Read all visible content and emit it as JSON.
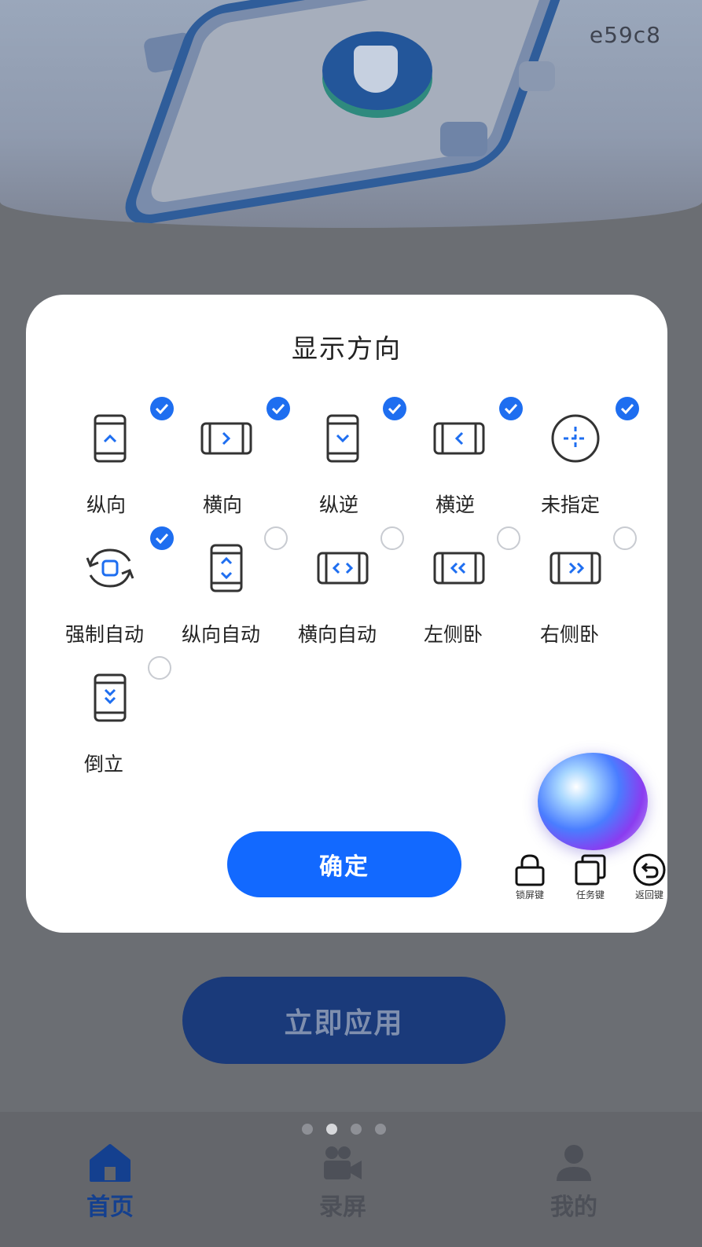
{
  "hero": {
    "code": "e59c8"
  },
  "dialog": {
    "title": "显示方向",
    "options": [
      {
        "label": "纵向",
        "checked": true,
        "icon": "portrait-up-icon"
      },
      {
        "label": "横向",
        "checked": true,
        "icon": "landscape-right-icon"
      },
      {
        "label": "纵逆",
        "checked": true,
        "icon": "portrait-down-icon"
      },
      {
        "label": "横逆",
        "checked": true,
        "icon": "landscape-left-icon"
      },
      {
        "label": "未指定",
        "checked": true,
        "icon": "crosshair-icon"
      },
      {
        "label": "强制自动",
        "checked": true,
        "icon": "rotate-auto-icon"
      },
      {
        "label": "纵向自动",
        "checked": false,
        "icon": "portrait-auto-icon"
      },
      {
        "label": "横向自动",
        "checked": false,
        "icon": "landscape-auto-icon"
      },
      {
        "label": "左侧卧",
        "checked": false,
        "icon": "lie-left-icon"
      },
      {
        "label": "右侧卧",
        "checked": false,
        "icon": "lie-right-icon"
      },
      {
        "label": "倒立",
        "checked": false,
        "icon": "upside-down-icon"
      }
    ],
    "confirm_label": "确定"
  },
  "floating": {
    "keys": [
      {
        "label": "锁屏键",
        "icon": "lock-icon"
      },
      {
        "label": "任务键",
        "icon": "tasks-icon"
      },
      {
        "label": "返回键",
        "icon": "back-icon"
      }
    ]
  },
  "main": {
    "apply_label": "立即应用",
    "pager": {
      "count": 4,
      "active": 2
    }
  },
  "tabbar": {
    "items": [
      {
        "label": "首页",
        "icon": "home-icon",
        "active": true
      },
      {
        "label": "录屏",
        "icon": "video-camera-icon",
        "active": false
      },
      {
        "label": "我的",
        "icon": "user-icon",
        "active": false
      }
    ]
  },
  "colors": {
    "accent": "#1269ff",
    "check": "#1e6ef0",
    "overlay": "#6b6e73"
  }
}
